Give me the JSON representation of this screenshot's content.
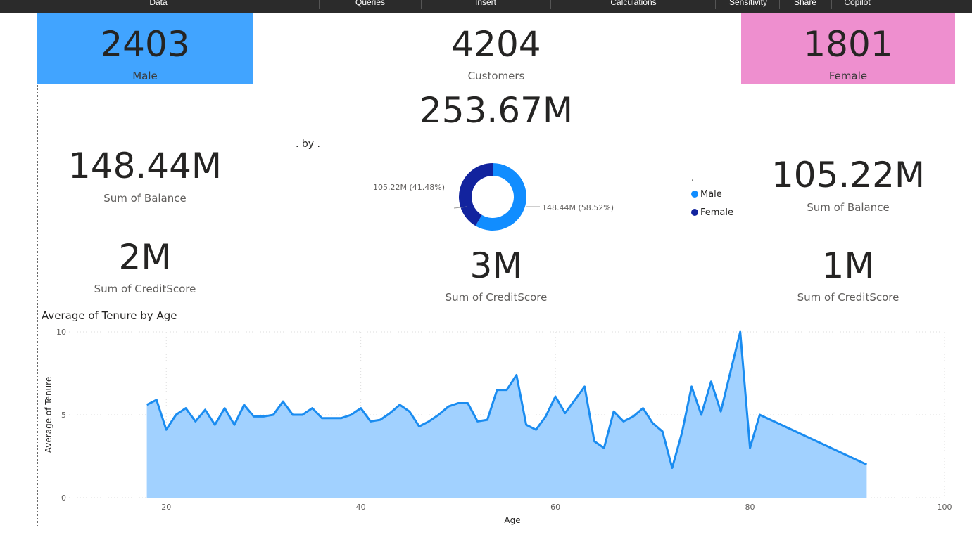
{
  "ribbon": {
    "tabs": [
      "Data",
      "Queries",
      "Insert",
      "Calculations",
      "Sensitivity",
      "Share",
      "Copilot"
    ]
  },
  "colors": {
    "male_card": "#41a4ff",
    "female_card": "#ee8fcf",
    "male_series": "#118dff",
    "female_series": "#12239e",
    "area_fill": "#a1d1ff",
    "area_line": "#1a8cf0"
  },
  "kpis": {
    "male_count": {
      "value": "2403",
      "label": "Male"
    },
    "customers": {
      "value": "4204",
      "label": "Customers"
    },
    "female_count": {
      "value": "1801",
      "label": "Female"
    },
    "total_balance": {
      "value": "253.67M"
    },
    "male_balance": {
      "value": "148.44M",
      "label": "Sum of Balance"
    },
    "female_balance": {
      "value": "105.22M",
      "label": "Sum of Balance"
    },
    "male_credit": {
      "value": "2M",
      "label": "Sum of CreditScore"
    },
    "total_credit": {
      "value": "3M",
      "label": "Sum of CreditScore"
    },
    "female_credit": {
      "value": "1M",
      "label": "Sum of CreditScore"
    }
  },
  "donut": {
    "title": ". by .",
    "legend_title": ".",
    "legend": [
      "Male",
      "Female"
    ],
    "labels": {
      "male": "148.44M (58.52%)",
      "female": "105.22M (41.48%)"
    }
  },
  "chart_data": [
    {
      "type": "pie",
      "title": ". by .",
      "categories": [
        "Male",
        "Female"
      ],
      "values": [
        148.44,
        105.22
      ],
      "percent": [
        58.52,
        41.48
      ],
      "legend": "right"
    },
    {
      "type": "area",
      "title": "Average of Tenure by Age",
      "xlabel": "Age",
      "ylabel": "Average of Tenure",
      "xlim": [
        10,
        100
      ],
      "ylim": [
        0,
        10
      ],
      "xticks": [
        20,
        40,
        60,
        80,
        100
      ],
      "yticks": [
        0,
        5,
        10
      ],
      "grid": true,
      "x": [
        18,
        19,
        20,
        21,
        22,
        23,
        24,
        25,
        26,
        27,
        28,
        29,
        30,
        31,
        32,
        33,
        34,
        35,
        36,
        37,
        38,
        39,
        40,
        41,
        42,
        43,
        44,
        45,
        46,
        47,
        48,
        49,
        50,
        51,
        52,
        53,
        54,
        55,
        56,
        57,
        58,
        59,
        60,
        61,
        62,
        63,
        64,
        65,
        66,
        67,
        68,
        69,
        70,
        71,
        72,
        73,
        74,
        75,
        76,
        77,
        78,
        79,
        80,
        81,
        92
      ],
      "y": [
        5.6,
        5.9,
        4.1,
        5.0,
        5.4,
        4.6,
        5.3,
        4.4,
        5.4,
        4.4,
        5.6,
        4.9,
        4.9,
        5.0,
        5.8,
        5.0,
        5.0,
        5.4,
        4.8,
        4.8,
        4.8,
        5.0,
        5.4,
        4.6,
        4.7,
        5.1,
        5.6,
        5.2,
        4.3,
        4.6,
        5.0,
        5.5,
        5.7,
        5.7,
        4.6,
        4.7,
        6.5,
        6.5,
        7.4,
        4.4,
        4.1,
        4.9,
        6.1,
        5.1,
        5.9,
        6.7,
        3.4,
        3.0,
        5.2,
        4.6,
        4.9,
        5.4,
        4.5,
        4.0,
        1.8,
        3.9,
        6.7,
        5.0,
        7.0,
        5.2,
        7.6,
        10.0,
        3.0,
        5.0,
        2.0
      ]
    }
  ]
}
